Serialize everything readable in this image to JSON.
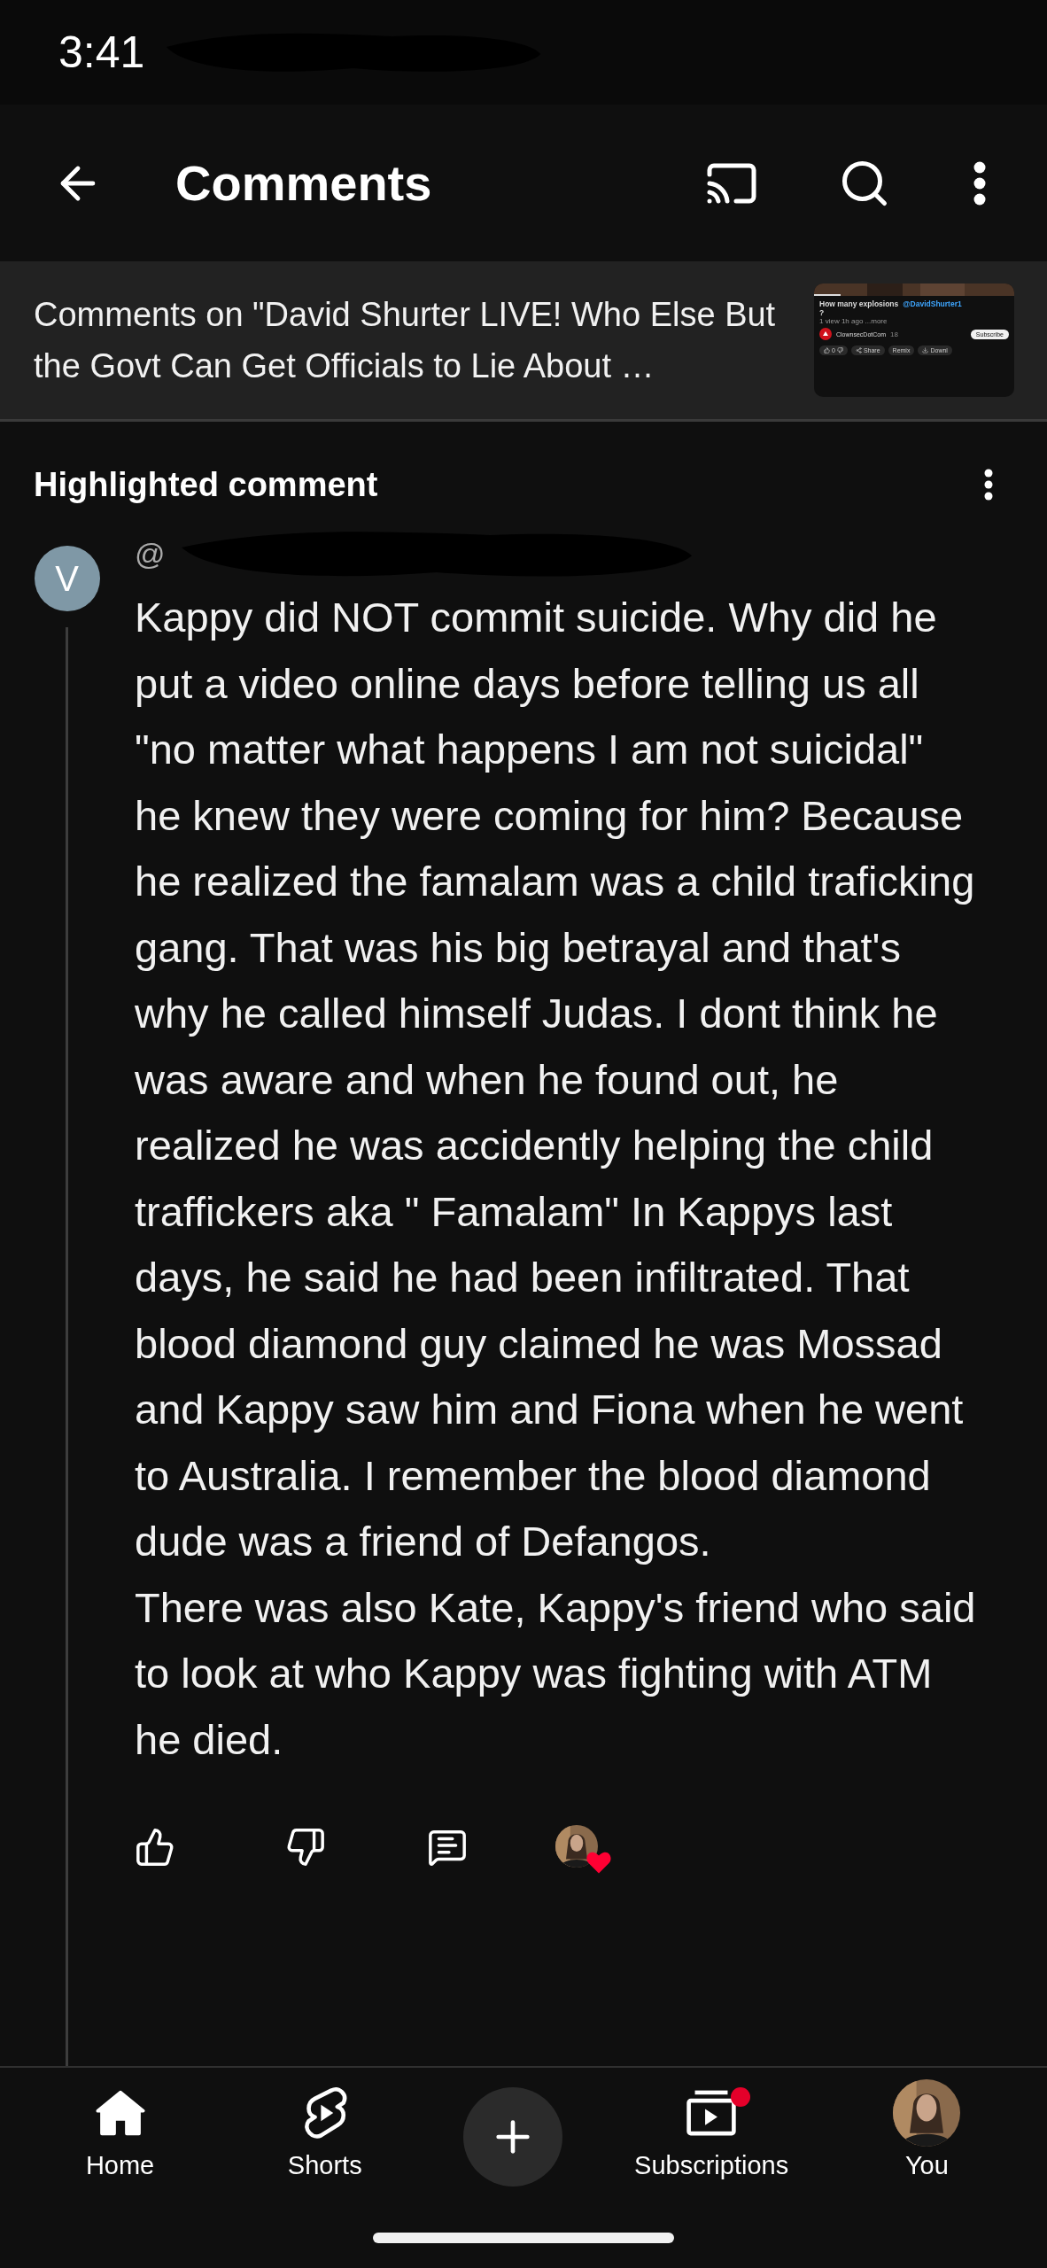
{
  "status_bar": {
    "time": "3:41"
  },
  "header": {
    "title": "Comments"
  },
  "video": {
    "caption": "Comments on \"David Shurter LIVE! Who Else But the Govt Can Get Officials to Lie About …",
    "thumbnail": {
      "title": "How many explosions",
      "mention": "@DavidShurter1",
      "title_end": "?",
      "meta": "1 view  1h ago  ...more",
      "channel": "ClownsecDotCom",
      "subscribers": "18",
      "subscribe": "Subscribe",
      "likes": "0",
      "share": "Share",
      "remix": "Remix",
      "download": "Downl"
    }
  },
  "section_title": "Highlighted comment",
  "comment": {
    "avatar_letter": "V",
    "author": "@",
    "paragraphs": [
      "Kappy did NOT commit suicide. Why did he put a video online days before telling us all \"no matter what happens I am not suicidal\" he knew they were coming for him? Because he realized the famalam was a child traficking gang. That was his big betrayal and that's why he called himself Judas. I dont think he was aware and when he found out, he realized he was accidently helping the child traffickers aka \" Famalam\"  In Kappys last days, he said he had been infiltrated. That blood diamond guy claimed he was Mossad and Kappy saw him and Fiona when he went to Australia. I remember the blood diamond dude was a friend of Defangos.",
      "There was also Kate, Kappy's friend who said to look at who Kappy was fighting with ATM he died."
    ],
    "hearted": true
  },
  "bottom_nav": [
    {
      "kind": "home",
      "label": "Home",
      "selected": true
    },
    {
      "kind": "shorts",
      "label": "Shorts",
      "selected": false
    },
    {
      "kind": "create",
      "selected": false
    },
    {
      "kind": "subscriptions",
      "label": "Subscriptions",
      "selected": false,
      "has_new": true
    },
    {
      "kind": "you",
      "label": "You",
      "selected": false
    }
  ]
}
